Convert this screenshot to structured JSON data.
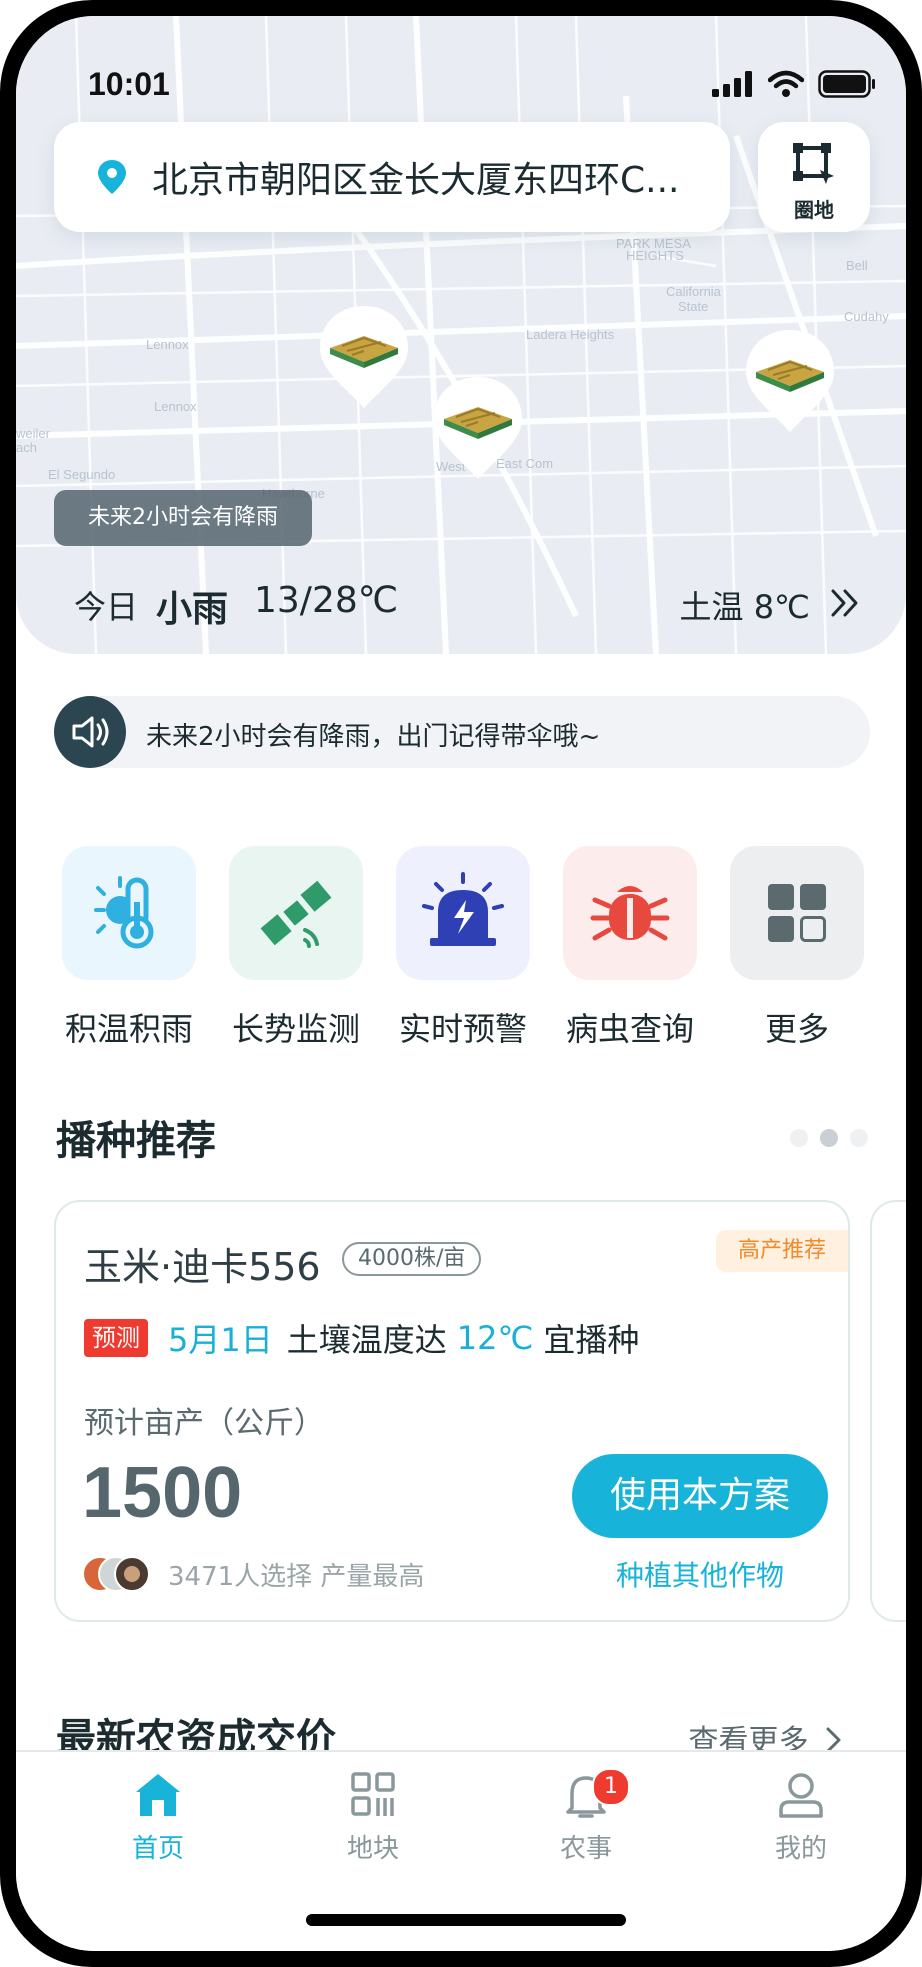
{
  "status_bar": {
    "time": "10:01"
  },
  "search": {
    "address": "北京市朝阳区金长大厦东四环C..."
  },
  "draw_button": {
    "label": "圈地"
  },
  "rain_tip": "未来2小时会有降雨",
  "weather": {
    "today": "今日",
    "condition": "小雨",
    "temp": "13/28℃",
    "soil": "土温 8℃"
  },
  "notice": {
    "text": "未来2小时会有降雨，出门记得带伞哦~"
  },
  "tools": [
    {
      "label": "积温积雨",
      "icon": "temperature-rain-icon",
      "color": "#eaf6fd"
    },
    {
      "label": "长势监测",
      "icon": "satellite-icon",
      "color": "#e9f5f1"
    },
    {
      "label": "实时预警",
      "icon": "alarm-siren-icon",
      "color": "#eef1fd"
    },
    {
      "label": "病虫查询",
      "icon": "bug-icon",
      "color": "#fdecec"
    },
    {
      "label": "更多",
      "icon": "grid-more-icon",
      "color": "#eceeef"
    }
  ],
  "sowing": {
    "title": "播种推荐",
    "card": {
      "crop": "玉米·迪卡556",
      "density": "4000株/亩",
      "tag": "高产推荐",
      "pred_tag": "预测",
      "date": "5月1日",
      "cond1": "土壤温度达",
      "temp": "12℃",
      "cond2": "宜播种",
      "yield_label": "预计亩产（公斤）",
      "yield": "1500",
      "chosen": "3471人选择 产量最高",
      "use_button": "使用本方案",
      "other_link": "种植其他作物"
    }
  },
  "prices": {
    "title": "最新农资成交价",
    "more": "查看更多"
  },
  "tabs": [
    {
      "label": "首页",
      "icon": "home-icon",
      "active": true
    },
    {
      "label": "地块",
      "icon": "plots-icon",
      "active": false
    },
    {
      "label": "农事",
      "icon": "bell-icon",
      "active": false,
      "badge": "1"
    },
    {
      "label": "我的",
      "icon": "profile-icon",
      "active": false
    }
  ],
  "colors": {
    "accent": "#17b3d9",
    "warning": "#ee3a2f",
    "highlight": "#f08a2b"
  }
}
